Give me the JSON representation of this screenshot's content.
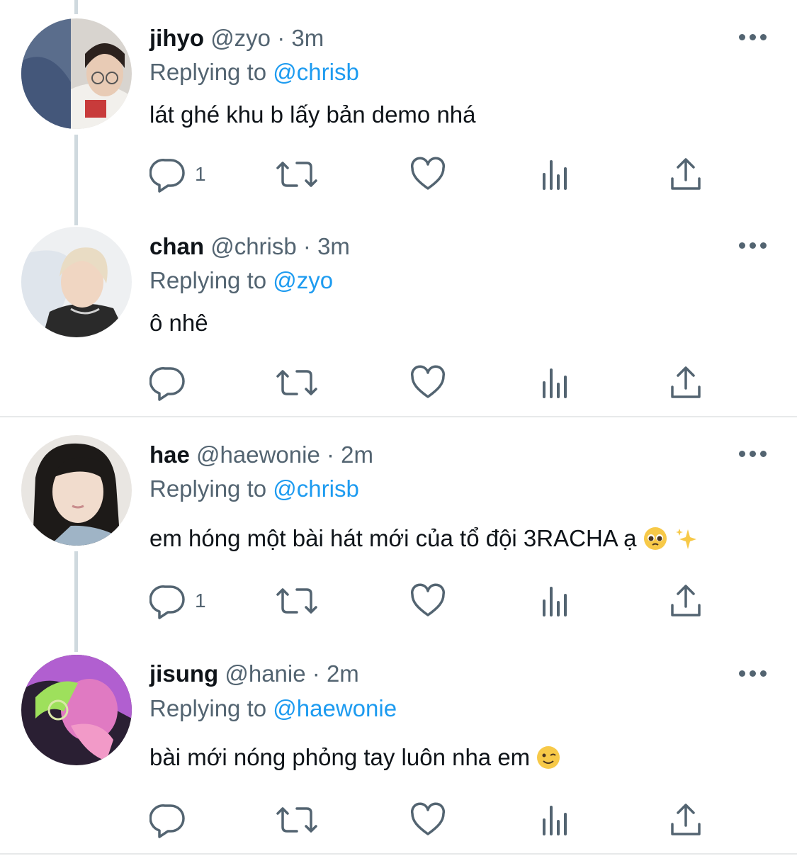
{
  "colors": {
    "link": "#1d9bf0",
    "muted": "#536471",
    "text": "#0f1419",
    "thread": "#cfd9de"
  },
  "tweets": [
    {
      "name": "jihyo",
      "handle": "@zyo",
      "dot": "·",
      "time": "3m",
      "replying_prefix": "Replying to",
      "replying_handle": "@chrisb",
      "text": "lát ghé khu b lấy bản demo nhá",
      "reply_count": "1",
      "avatar": "photo-girl-glasses"
    },
    {
      "name": "chan",
      "handle": "@chrisb",
      "dot": "·",
      "time": "3m",
      "replying_prefix": "Replying to",
      "replying_handle": "@zyo",
      "text": "ô nhê",
      "reply_count": "",
      "avatar": "photo-blond-boy"
    },
    {
      "name": "hae",
      "handle": "@haewonie",
      "dot": "·",
      "time": "2m",
      "replying_prefix": "Replying to",
      "replying_handle": "@chrisb",
      "text": "em hóng một bài hát mới của tổ đội 3RACHA ạ",
      "emoji": [
        "pleading-face-emoji",
        "sparkles-emoji"
      ],
      "reply_count": "1",
      "avatar": "photo-dark-hair-girl"
    },
    {
      "name": "jisung",
      "handle": "@hanie",
      "dot": "·",
      "time": "2m",
      "replying_prefix": "Replying to",
      "replying_handle": "@haewonie",
      "text": "bài mới nóng phỏng tay luôn nha em",
      "emoji": [
        "winking-face-emoji"
      ],
      "reply_count": "",
      "avatar": "photo-pink-light-boy"
    }
  ]
}
